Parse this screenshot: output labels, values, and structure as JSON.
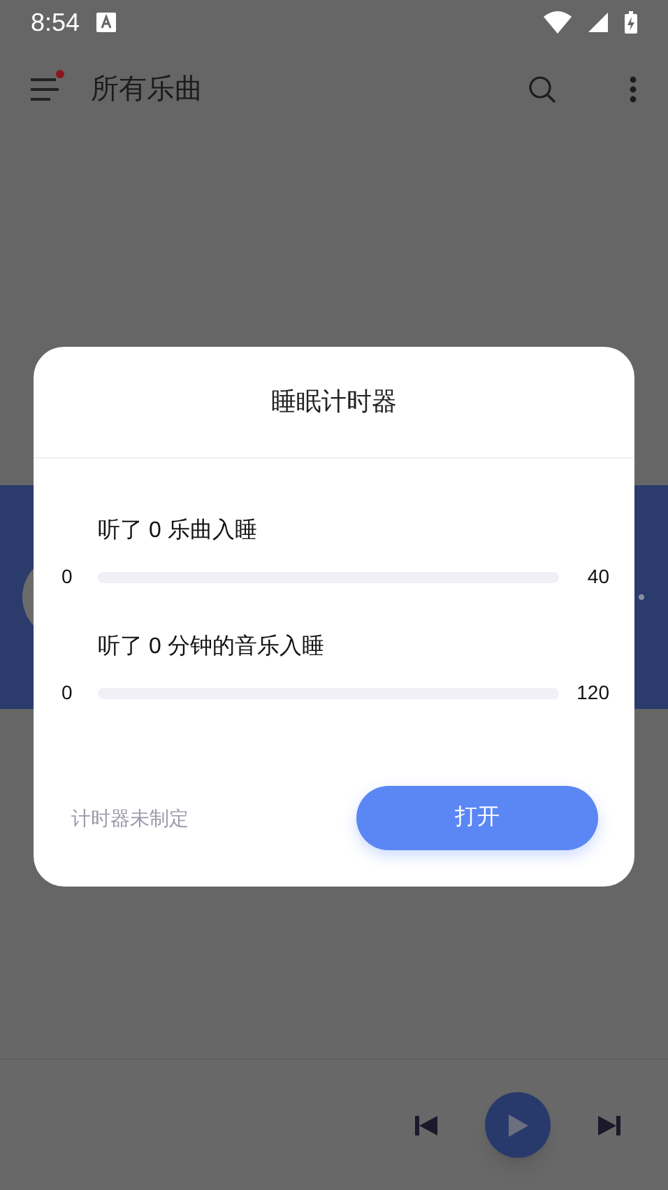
{
  "status_bar": {
    "time": "8:54"
  },
  "top_bar": {
    "title": "所有乐曲",
    "menu_badge": true
  },
  "dialog": {
    "title": "睡眠计时器",
    "sliders": [
      {
        "label": "听了 0 乐曲入睡",
        "min": "0",
        "max": "40",
        "level": 0
      },
      {
        "label": "听了 0 分钟的音乐入睡",
        "min": "0",
        "max": "120",
        "level": 0
      }
    ],
    "status": "计时器未制定",
    "button": "打开"
  }
}
